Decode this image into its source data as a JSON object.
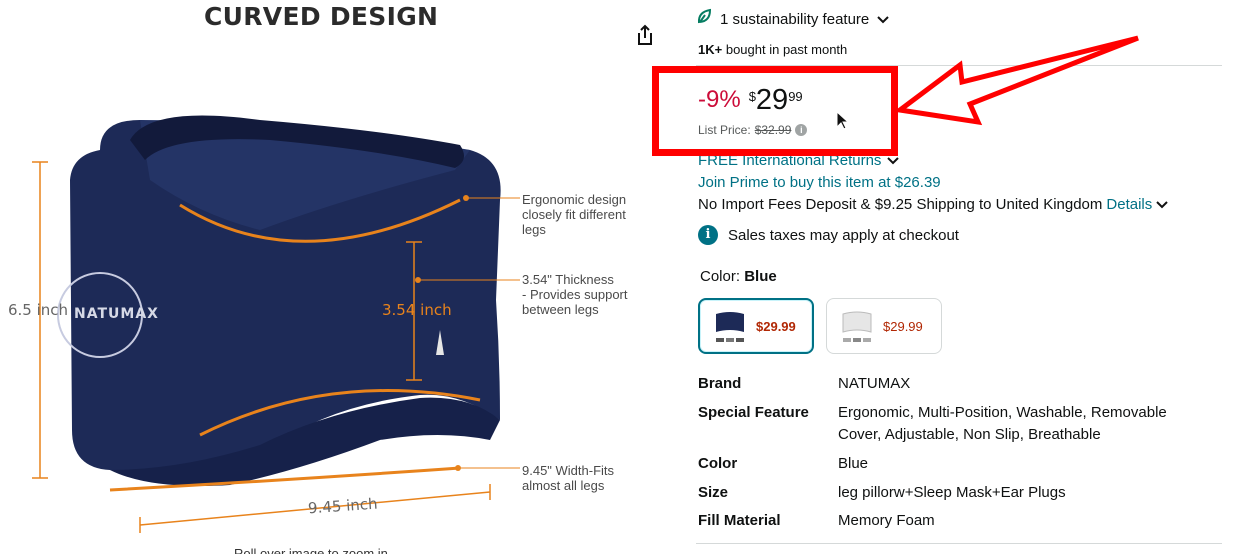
{
  "image_panel": {
    "title": "CURVED DESIGN",
    "height_label": "6.5 inch",
    "thickness_label": "3.54 inch",
    "width_label": "9.45 inch",
    "logo_text": "NATUMAX",
    "callouts": [
      "Ergonomic design closely fit different legs",
      "3.54\" Thickness\n - Provides support between legs",
      "9.45\" Width-Fits almost all legs"
    ],
    "rollover_text": "Roll over image to zoom in",
    "share_icon": "share-icon"
  },
  "sustainability": {
    "label": "1 sustainability feature",
    "icon": "leaf-icon"
  },
  "bought": {
    "count": "1K+",
    "text": "bought in past month"
  },
  "price": {
    "discount": "-9%",
    "symbol": "$",
    "whole": "29",
    "fraction": "99",
    "list_label": "List Price:",
    "list_value": "$32.99"
  },
  "shipping": {
    "free_returns": "FREE International Returns",
    "prime": "Join Prime to buy this item at $26.39",
    "import_fees": "No Import Fees Deposit & $9.25 Shipping to United Kingdom",
    "details_link": "Details",
    "tax_note": "Sales taxes may apply at checkout"
  },
  "color": {
    "label": "Color:",
    "selected": "Blue",
    "options": [
      {
        "name": "Blue",
        "price": "$29.99",
        "selected": true
      },
      {
        "name": "White",
        "price": "$29.99",
        "selected": false
      }
    ]
  },
  "specs": [
    {
      "key": "Brand",
      "value": "NATUMAX"
    },
    {
      "key": "Special Feature",
      "value": "Ergonomic, Multi-Position, Washable, Removable Cover, Adjustable, Non Slip, Breathable"
    },
    {
      "key": "Color",
      "value": "Blue"
    },
    {
      "key": "Size",
      "value": "leg pillorw+Sleep Mask+Ear Plugs"
    },
    {
      "key": "Fill Material",
      "value": "Memory Foam"
    }
  ],
  "colors": {
    "accent": "#007185",
    "discount": "#cc0c39",
    "highlight": "#ff0000",
    "pillow": "#1b2a55",
    "dimension": "#e8831c"
  }
}
